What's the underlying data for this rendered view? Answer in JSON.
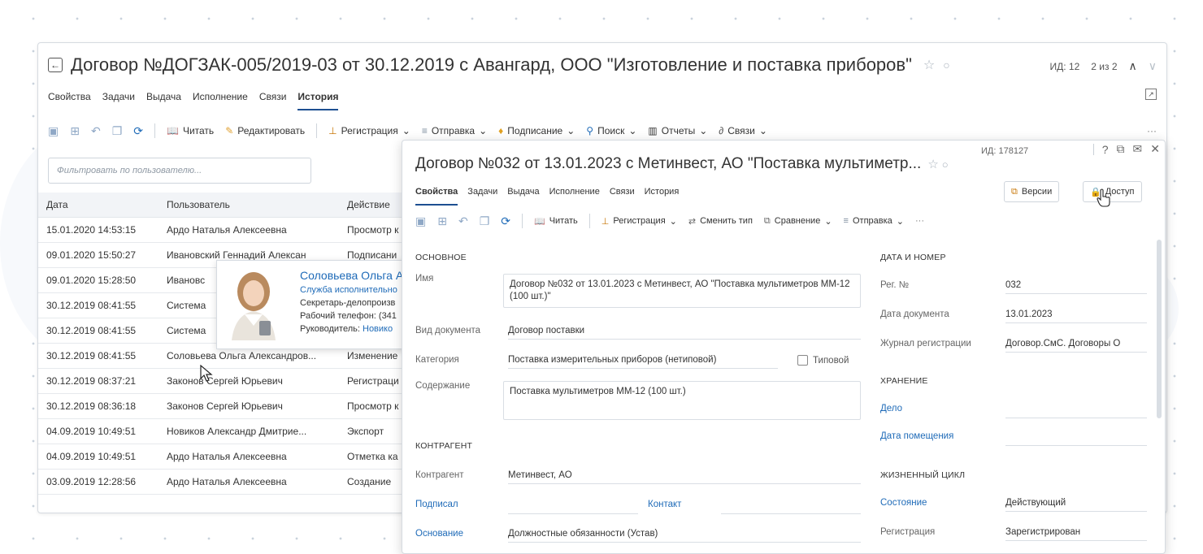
{
  "main_window": {
    "title": "Договор №ДОГЗАК-005/2019-03 от 30.12.2019 с Авангард, ООО \"Изготовление и поставка приборов\"",
    "id_text": "ИД: 12",
    "position_text": "2 из 2",
    "tabs": [
      "Свойства",
      "Задачи",
      "Выдача",
      "Исполнение",
      "Связи",
      "История"
    ],
    "active_tab": "История",
    "toolbar": {
      "read": "Читать",
      "edit": "Редактировать",
      "registration": "Регистрация",
      "send": "Отправка",
      "sign": "Подписание",
      "search": "Поиск",
      "reports": "Отчеты",
      "links": "Связи",
      "more": "···"
    },
    "filter_placeholder": "Фильтровать по пользователю...",
    "history": {
      "columns": [
        "Дата",
        "Пользователь",
        "Действие"
      ],
      "rows": [
        [
          "15.01.2020 14:53:15",
          "Ардо Наталья Алексеевна",
          "Просмотр к"
        ],
        [
          "09.01.2020 15:50:27",
          "Ивановский Геннадий Алексан",
          "Подписани"
        ],
        [
          "09.01.2020 15:28:50",
          "Ивановс",
          ""
        ],
        [
          "30.12.2019 08:41:55",
          "Система",
          ""
        ],
        [
          "30.12.2019 08:41:55",
          "Система",
          ""
        ],
        [
          "30.12.2019 08:41:55",
          "Соловьева Ольга Александров...",
          "Изменение"
        ],
        [
          "30.12.2019 08:37:21",
          "Законов Сергей Юрьевич",
          "Регистраци"
        ],
        [
          "30.12.2019 08:36:18",
          "Законов Сергей Юрьевич",
          "Просмотр к"
        ],
        [
          "04.09.2019 10:49:51",
          "Новиков Александр Дмитрие...",
          "Экспорт"
        ],
        [
          "04.09.2019 10:49:51",
          "Ардо Наталья Алексеевна",
          "Отметка ка"
        ],
        [
          "03.09.2019 12:28:56",
          "Ардо Наталья Алексеевна",
          "Создание"
        ]
      ]
    }
  },
  "user_popup": {
    "name": "Соловьева Ольга Ал",
    "department": "Служба исполнительно",
    "position": "Секретарь-делопроизв",
    "phone": "Рабочий телефон: (341",
    "manager_label": "Руководитель:",
    "manager": "Новико"
  },
  "doc_window": {
    "title": "Договор №032 от 13.01.2023 с Метинвест, АО \"Поставка мультиметр...",
    "id_text": "ИД: 178127",
    "tabs": [
      "Свойства",
      "Задачи",
      "Выдача",
      "Исполнение",
      "Связи",
      "История"
    ],
    "active_tab": "Свойства",
    "versions_button": "Версии",
    "access_button": "Доступ",
    "toolbar": {
      "read": "Читать",
      "registration": "Регистрация",
      "change_type": "Сменить тип",
      "compare": "Сравнение",
      "send": "Отправка",
      "more": "···"
    },
    "sections": {
      "main": "ОСНОВНОЕ",
      "counterparty": "КОНТРАГЕНТ",
      "date_number": "ДАТА И НОМЕР",
      "storage": "ХРАНЕНИЕ",
      "lifecycle": "ЖИЗНЕННЫЙ ЦИКЛ"
    },
    "fields": {
      "name_label": "Имя",
      "name_value": "Договор №032 от 13.01.2023 с Метинвест, АО \"Поставка мультиметров ММ-12 (100 шт.)\"",
      "doctype_label": "Вид документа",
      "doctype_value": "Договор поставки",
      "category_label": "Категория",
      "category_value": "Поставка измерительных приборов (нетиповой)",
      "typical_label": "Типовой",
      "content_label": "Содержание",
      "content_value": "Поставка мультиметров ММ-12 (100 шт.)",
      "counterparty_label": "Контрагент",
      "counterparty_value": "Метинвест, АО",
      "signed_label": "Подписал",
      "contact_label": "Контакт",
      "basis_label": "Основание",
      "basis_value": "Должностные обязанности (Устав)",
      "regno_label": "Рег. №",
      "regno_value": "032",
      "docdate_label": "Дата документа",
      "docdate_value": "13.01.2023",
      "journal_label": "Журнал регистрации",
      "journal_value": "Договор.СмС. Договоры О",
      "case_label": "Дело",
      "placement_label": "Дата помещения",
      "state_label": "Состояние",
      "state_value": "Действующий",
      "registration_label": "Регистрация",
      "registration_value": "Зарегистрирован"
    }
  },
  "colors": {
    "accent": "#1d4f91",
    "link": "#1f6bb8",
    "icon_inactive": "#8fa8c6",
    "border": "#d6dbe1"
  }
}
